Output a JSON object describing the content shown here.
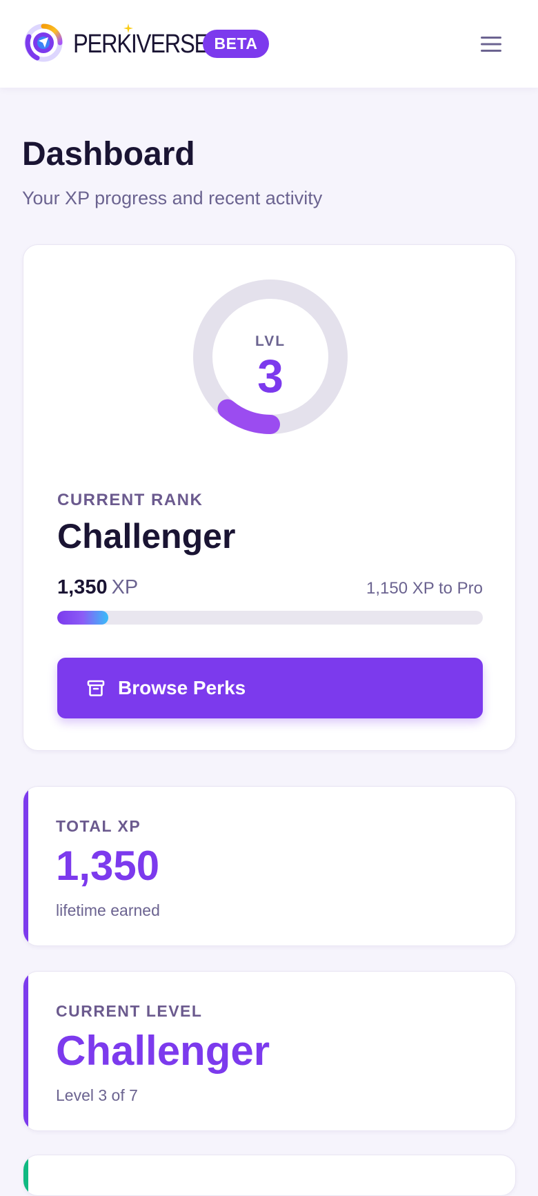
{
  "header": {
    "brand": "PERKIVERSE",
    "badge": "BETA",
    "menu_icon": "hamburger-menu-icon",
    "logo_icon": "perkiverse-logo-icon"
  },
  "page": {
    "title": "Dashboard",
    "subtitle": "Your XP progress and recent activity"
  },
  "level_card": {
    "ring_label": "LVL",
    "level_number": "3",
    "ring_progress": 0.11,
    "rank_label": "CURRENT RANK",
    "rank_name": "Challenger",
    "xp_value": "1,350",
    "xp_unit": "XP",
    "xp_to_next": "1,150 XP to Pro",
    "bar_progress": 0.12,
    "button_label": "Browse Perks",
    "button_icon": "archive-box-icon"
  },
  "stats": [
    {
      "label": "TOTAL XP",
      "value": "1,350",
      "sub": "lifetime earned"
    },
    {
      "label": "CURRENT LEVEL",
      "value": "Challenger",
      "sub": "Level 3 of 7"
    }
  ],
  "colors": {
    "accent": "#7c3aed",
    "ring_track": "#e4e1ec",
    "bar_end": "#38bdf8",
    "next_accent": "#10b981"
  }
}
